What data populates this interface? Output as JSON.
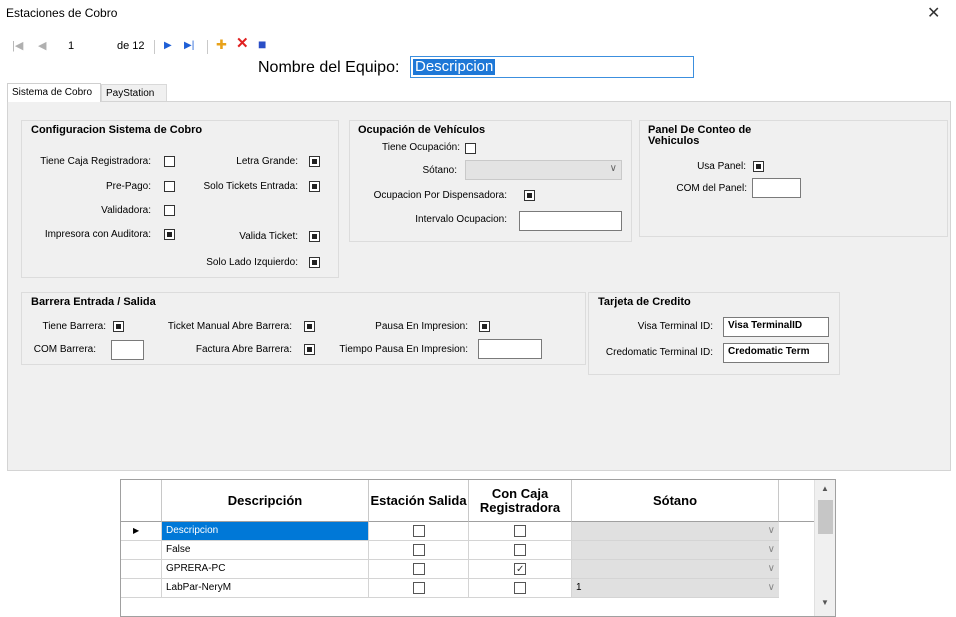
{
  "window": {
    "title": "Estaciones de Cobro",
    "close_glyph": "✕"
  },
  "toolbar": {
    "first_glyph": "|◀",
    "prev_glyph": "◀",
    "position": "1",
    "of_label": "de 12",
    "next_glyph": "▶",
    "last_glyph": "▶|",
    "add_glyph": "✚",
    "delete_glyph": "✕",
    "save_glyph": "■"
  },
  "equipo": {
    "label": "Nombre del Equipo:",
    "value": "Descripcion"
  },
  "tabs": [
    {
      "label": "Sistema de Cobro"
    },
    {
      "label": "PayStation"
    }
  ],
  "config": {
    "title": "Configuracion Sistema de Cobro",
    "caja_label": "Tiene Caja Registradora:",
    "caja_checked": false,
    "prepago_label": "Pre-Pago:",
    "prepago_checked": false,
    "validadora_label": "Validadora:",
    "validadora_checked": false,
    "impresora_label": "Impresora con Auditora:",
    "impresora_checked": true,
    "letra_label": "Letra Grande:",
    "letra_checked": true,
    "solo_entrada_label": "Solo Tickets Entrada:",
    "solo_entrada_checked": true,
    "valida_label": "Valida Ticket:",
    "valida_checked": true,
    "izquierdo_label": "Solo Lado Izquierdo:",
    "izquierdo_checked": true
  },
  "ocupacion": {
    "title": "Ocupación de Vehículos",
    "tiene_label": "Tiene Ocupación:",
    "tiene_checked": false,
    "sotano_label": "Sótano:",
    "sotano_value": "",
    "dispensadora_label": "Ocupacion Por Dispensadora:",
    "dispensadora_checked": true,
    "intervalo_label": "Intervalo Ocupacion:",
    "intervalo_value": ""
  },
  "panel": {
    "title_line1": "Panel De Conteo de",
    "title_line2": "Vehiculos",
    "usa_label": "Usa Panel:",
    "usa_checked": true,
    "com_label": "COM del Panel:",
    "com_value": ""
  },
  "barrera": {
    "title": "Barrera Entrada / Salida",
    "tiene_label": "Tiene Barrera:",
    "tiene_checked": true,
    "com_label": "COM Barrera:",
    "com_value": "",
    "manual_label": "Ticket Manual Abre Barrera:",
    "manual_checked": true,
    "factura_label": "Factura Abre Barrera:",
    "factura_checked": true,
    "pausa_label": "Pausa En Impresion:",
    "pausa_checked": true,
    "tiempo_label": "Tiempo Pausa En Impresion:",
    "tiempo_value": ""
  },
  "tarjeta": {
    "title": "Tarjeta de Credito",
    "visa_label": "Visa Terminal ID:",
    "visa_value": "Visa TerminalID",
    "credo_label": "Credomatic Terminal ID:",
    "credo_value": "Credomatic Term"
  },
  "grid": {
    "headers": {
      "descripcion": "Descripción",
      "estacion": "Estación Salida",
      "con_caja": "Con Caja Registradora",
      "sotano": "Sótano"
    },
    "row_marker": "▶",
    "rows": [
      {
        "descripcion": "Descripcion",
        "estacion": false,
        "con_caja": false,
        "sotano": ""
      },
      {
        "descripcion": "False",
        "estacion": false,
        "con_caja": false,
        "sotano": ""
      },
      {
        "descripcion": "GPRERA-PC",
        "estacion": false,
        "con_caja": true,
        "sotano": ""
      },
      {
        "descripcion": "LabPar-NeryM",
        "estacion": false,
        "con_caja": false,
        "sotano": "1"
      }
    ],
    "scroll_up": "▲",
    "scroll_down": "▼"
  }
}
